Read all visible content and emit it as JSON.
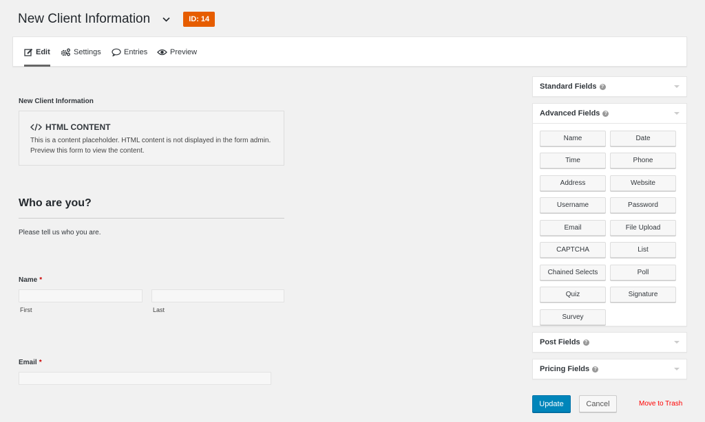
{
  "header": {
    "title": "New Client Information",
    "id_badge": "ID: 14"
  },
  "tabs": [
    {
      "label": "Edit",
      "icon": "edit-icon",
      "active": true
    },
    {
      "label": "Settings",
      "icon": "gears-icon",
      "active": false
    },
    {
      "label": "Entries",
      "icon": "comment-icon",
      "active": false
    },
    {
      "label": "Preview",
      "icon": "eye-icon",
      "active": false
    }
  ],
  "form": {
    "name": "New Client Information",
    "html_block": {
      "title": "HTML CONTENT",
      "description": "This is a content placeholder. HTML content is not displayed in the form admin. Preview this form to view the content."
    },
    "section": {
      "title": "Who are you?",
      "description": "Please tell us who you are."
    },
    "fields": {
      "name": {
        "label": "Name",
        "required_marker": "*",
        "first_value": "",
        "last_value": "",
        "first_label": "First",
        "last_label": "Last"
      },
      "email": {
        "label": "Email",
        "required_marker": "*",
        "value": ""
      }
    }
  },
  "sidebar": {
    "help_glyph": "?",
    "standard_fields": {
      "label": "Standard Fields"
    },
    "advanced_fields": {
      "label": "Advanced Fields",
      "buttons": [
        "Name",
        "Date",
        "Time",
        "Phone",
        "Address",
        "Website",
        "Username",
        "Password",
        "Email",
        "File Upload",
        "CAPTCHA",
        "List",
        "Chained Selects",
        "Poll",
        "Quiz",
        "Signature",
        "Survey"
      ]
    },
    "post_fields": {
      "label": "Post Fields"
    },
    "pricing_fields": {
      "label": "Pricing Fields"
    }
  },
  "actions": {
    "update": "Update",
    "cancel": "Cancel",
    "trash": "Move to Trash"
  },
  "colors": {
    "accent": "#0085ba",
    "badge": "#e65d00",
    "trash": "#ff0000",
    "required": "#cc0000"
  }
}
